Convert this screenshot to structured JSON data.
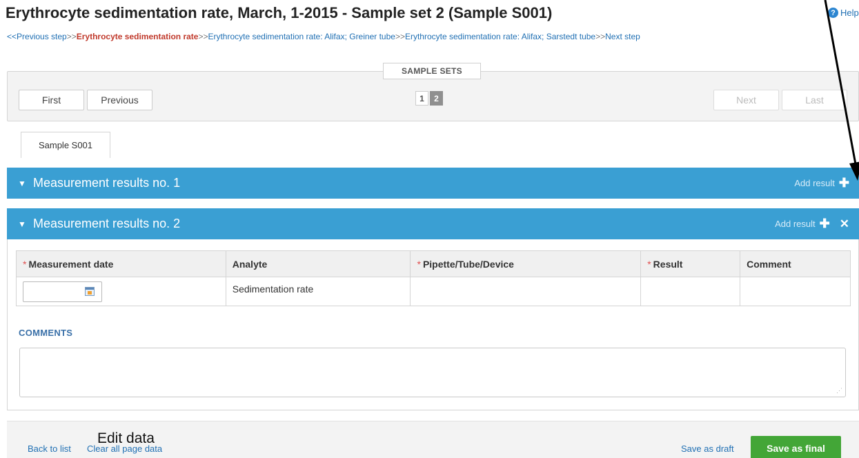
{
  "page": {
    "title": "Erythrocyte sedimentation rate, March, 1-2015 - Sample set 2 (Sample S001)",
    "help_label": "Help"
  },
  "breadcrumb": {
    "prev": "<<Previous step",
    "sep": ">>",
    "current": "Erythrocyte sedimentation rate",
    "step1": "Erythrocyte sedimentation rate: Alifax; Greiner tube",
    "step2": "Erythrocyte sedimentation rate: Alifax; Sarstedt tube",
    "next": "Next step"
  },
  "sample_sets": {
    "legend": "SAMPLE SETS",
    "first": "First",
    "previous": "Previous",
    "next": "Next",
    "last": "Last",
    "pages": [
      "1",
      "2"
    ],
    "current_page": "2"
  },
  "sample_tab": {
    "label": "Sample S001"
  },
  "measurements": [
    {
      "title": "Measurement results no. 1",
      "add_label": "Add result",
      "collapse_glyph": "▼"
    },
    {
      "title": "Measurement results no. 2",
      "add_label": "Add result",
      "collapse_glyph": "▼"
    }
  ],
  "results_table": {
    "headers": {
      "date": "Measurement date",
      "analyte": "Analyte",
      "device": "Pipette/Tube/Device",
      "result": "Result",
      "comment": "Comment"
    },
    "required_mark": "*",
    "row": {
      "date": "",
      "analyte": "Sedimentation rate",
      "device": "",
      "result": "",
      "comment": ""
    }
  },
  "comments": {
    "label": "COMMENTS",
    "value": ""
  },
  "footer": {
    "back_to_list": "Back to list",
    "clear_all": "Clear all page data",
    "overlay_caption": "Edit data",
    "save_draft": "Save as draft",
    "save_final": "Save as final"
  },
  "colors": {
    "header_blue": "#3a9fd3",
    "save_green": "#43a637",
    "breadcrumb_current": "#c0392b",
    "link_blue": "#1f6fb3"
  }
}
